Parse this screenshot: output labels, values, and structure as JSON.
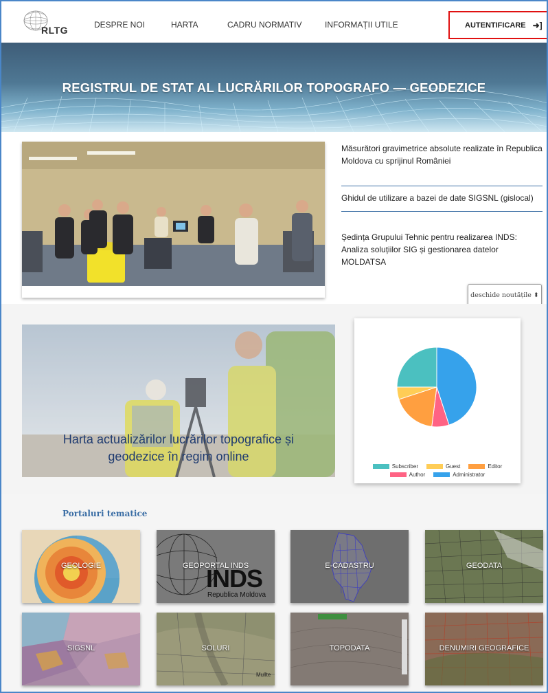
{
  "header": {
    "logo_text": "RLTG",
    "nav": [
      "DESPRE NOI",
      "HARTA",
      "CADRU NORMATIV",
      "INFORMAȚII UTILE"
    ],
    "auth_label": "AUTENTIFICARE",
    "auth_icon": "sign-in-icon"
  },
  "banner": {
    "title": "REGISTRUL DE STAT AL LUCRĂRILOR TOPOGRAFO — GEODEZICE"
  },
  "news": {
    "items": [
      "Măsurători gravimetrice absolute realizate în Republica Moldova cu sprijinul României",
      "Ghidul de utilizare a bazei de date SIGSNL (gislocal)",
      "Ședința Grupului Tehnic pentru realizarea INDS: Analiza soluțiilor SIG și gestionarea datelor MOLDATSA"
    ],
    "open_button": "deschide noutățile ⬍"
  },
  "map": {
    "caption_line1": "Harta actualizărilor lucrărilor topografice și",
    "caption_line2": "geodezice în regim online"
  },
  "chart_data": {
    "type": "pie",
    "title": "",
    "series": [
      {
        "name": "Subscriber",
        "value": 25,
        "color": "#4bc0c0"
      },
      {
        "name": "Guest",
        "value": 5,
        "color": "#ffcd56"
      },
      {
        "name": "Editor",
        "value": 18,
        "color": "#ff9f40"
      },
      {
        "name": "Author",
        "value": 7,
        "color": "#ff6384"
      },
      {
        "name": "Administrator",
        "value": 45,
        "color": "#36a2eb"
      }
    ],
    "legend_position": "bottom"
  },
  "portals": {
    "title": "Portaluri tematice",
    "tiles": [
      {
        "label": "GEOLOGIE"
      },
      {
        "label": "GEOPORTAL INDS",
        "overlay_big": "INDS",
        "overlay_small": "Republica Moldova"
      },
      {
        "label": "E-CADASTRU"
      },
      {
        "label": "GEODATA"
      },
      {
        "label": "SIGSNL"
      },
      {
        "label": "SOLURI",
        "map_text": "Mullte"
      },
      {
        "label": "TOPODATA"
      },
      {
        "label": "DENUMIRI GEOGRAFICE"
      }
    ]
  }
}
